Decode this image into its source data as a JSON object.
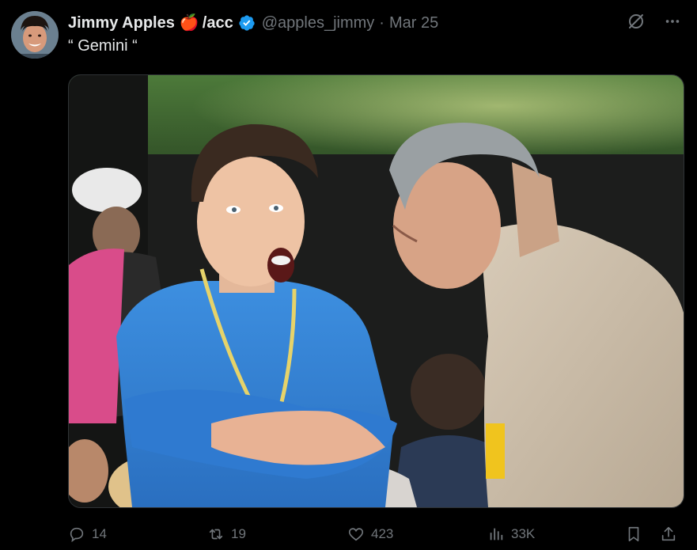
{
  "tweet": {
    "author": {
      "name": "Jimmy Apples",
      "name_suffix": "/acc",
      "emoji": "🍎",
      "handle": "@apples_jimmy",
      "verified": true,
      "avatar": "avatar-image"
    },
    "separator": "·",
    "date": "Mar 25",
    "text": "“ Gemini “",
    "top_icons": [
      "grok-icon",
      "more-icon"
    ],
    "media": {
      "alt": "photo of two men facing each other, one with open mouth in blue shirt and one in beige jacket"
    },
    "stats": {
      "replies": "14",
      "reposts": "19",
      "likes": "423",
      "views": "33K"
    },
    "action_icons": [
      "reply-icon",
      "repost-icon",
      "like-icon",
      "views-icon",
      "bookmark-icon",
      "share-icon"
    ],
    "colors": {
      "background": "#000000",
      "text": "#e7e9ea",
      "muted": "#71767b",
      "verified": "#1d9bf0"
    }
  }
}
